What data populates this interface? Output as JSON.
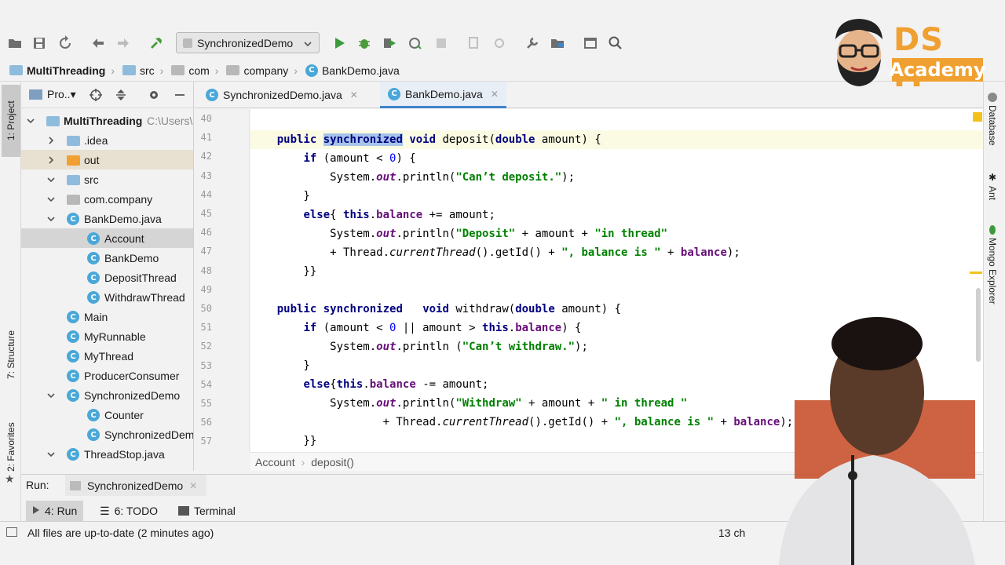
{
  "toolbar": {
    "run_config": "SynchronizedDemo"
  },
  "navbar": {
    "crumbs": [
      "MultiThreading",
      "src",
      "com",
      "company",
      "BankDemo.java"
    ]
  },
  "left_strip": {
    "project_tab": "1: Project",
    "structure_tab": "7: Structure",
    "favorites_tab": "2: Favorites"
  },
  "project": {
    "title": "Pro..▾",
    "tree": [
      {
        "label": "MultiThreading",
        "path": "C:\\Users\\"
      },
      {
        "label": ".idea"
      },
      {
        "label": "out"
      },
      {
        "label": "src"
      },
      {
        "label": "com.company"
      },
      {
        "label": "BankDemo.java"
      },
      {
        "label": "Account"
      },
      {
        "label": "BankDemo"
      },
      {
        "label": "DepositThread"
      },
      {
        "label": "WithdrawThread"
      },
      {
        "label": "Main"
      },
      {
        "label": "MyRunnable"
      },
      {
        "label": "MyThread"
      },
      {
        "label": "ProducerConsumer"
      },
      {
        "label": "SynchronizedDemo"
      },
      {
        "label": "Counter"
      },
      {
        "label": "SynchronizedDemo"
      },
      {
        "label": "ThreadStop.java"
      }
    ]
  },
  "editor": {
    "tabs": [
      {
        "label": "SynchronizedDemo.java"
      },
      {
        "label": "BankDemo.java"
      }
    ],
    "line_numbers": [
      "40",
      "41",
      "42",
      "43",
      "44",
      "45",
      "46",
      "47",
      "48",
      "49",
      "50",
      "51",
      "52",
      "53",
      "54",
      "55",
      "56",
      "57"
    ],
    "breadcrumb": [
      "Account",
      "deposit()"
    ]
  },
  "right_strip": {
    "database": "Database",
    "ant": "Ant",
    "mongo": "Mongo Explorer"
  },
  "run_panel": {
    "label": "Run:",
    "tab": "SynchronizedDemo"
  },
  "bottom_tabs": {
    "run": "4: Run",
    "todo": "6: TODO",
    "terminal": "Terminal"
  },
  "status": {
    "message": "All files are up-to-date (2 minutes ago)",
    "chars": "13 ch"
  },
  "logo": {
    "title": "DS IT",
    "subtitle": "Academy"
  }
}
